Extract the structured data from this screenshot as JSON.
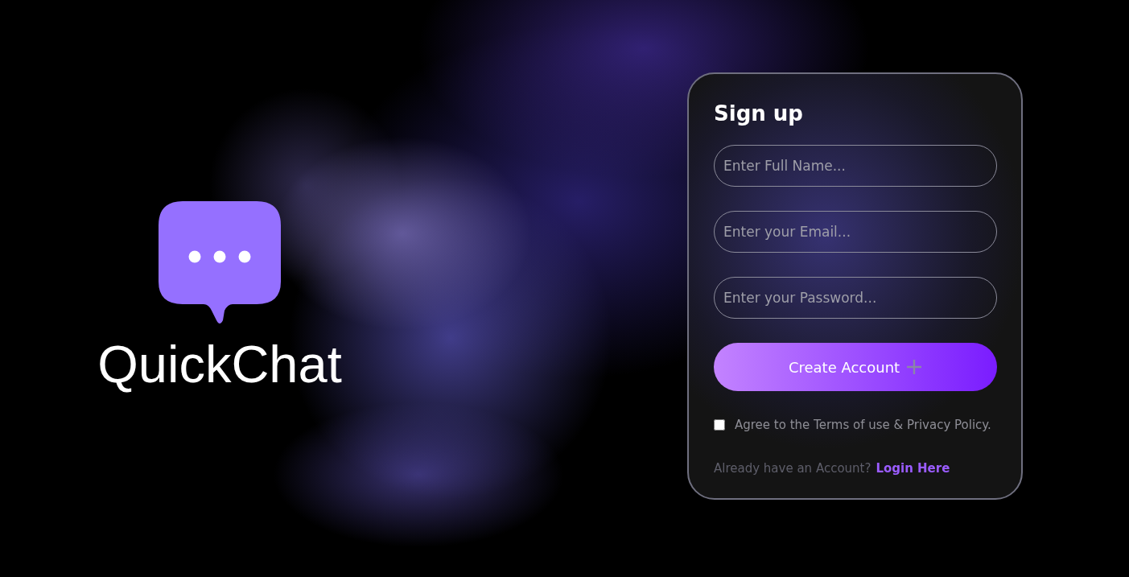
{
  "brand": {
    "name": "QuickChat"
  },
  "signup": {
    "title": "Sign up",
    "fields": [
      {
        "placeholder": "Enter Full Name..."
      },
      {
        "placeholder": "Enter your Email..."
      },
      {
        "placeholder": "Enter your Password..."
      }
    ],
    "submit": {
      "label": "Create Account"
    },
    "terms": {
      "label": "Agree to the Terms of use & Privacy Policy.",
      "checked": false
    },
    "login": {
      "prompt": "Already have an Account?",
      "link": "Login Here"
    }
  }
}
